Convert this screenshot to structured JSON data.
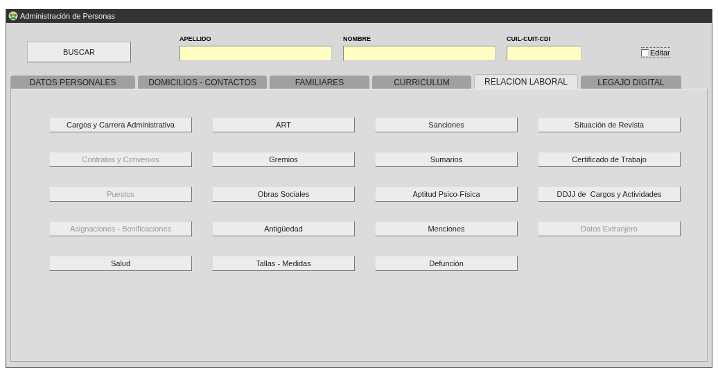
{
  "window": {
    "title": "Administración de Personas"
  },
  "search_button": "BUSCAR",
  "fields": [
    {
      "label": "APELLIDO"
    },
    {
      "label": "NOMBRE"
    },
    {
      "label": "CUIL-CUIT-CDI"
    }
  ],
  "edit_checkbox": {
    "label": "Editar",
    "checked": false
  },
  "tabs": [
    {
      "label": "DATOS PERSONALES",
      "selected": false
    },
    {
      "label": "DOMICILIOS - CONTACTOS",
      "selected": false
    },
    {
      "label": "FAMILIARES",
      "selected": false
    },
    {
      "label": "CURRICULUM",
      "selected": false
    },
    {
      "label": "RELACION LABORAL",
      "selected": true
    },
    {
      "label": "LEGAJO DIGITAL",
      "selected": false
    }
  ],
  "buttons": [
    {
      "label": "Cargos y Carrera Administrativa",
      "disabled": false
    },
    {
      "label": "ART",
      "disabled": false
    },
    {
      "label": "Sanciones",
      "disabled": false
    },
    {
      "label": "Situación de Revista",
      "disabled": false
    },
    {
      "label": "Contratos y Convenios",
      "disabled": true
    },
    {
      "label": "Gremios",
      "disabled": false
    },
    {
      "label": "Sumarios",
      "disabled": false
    },
    {
      "label": "Certificado de Trabajo",
      "disabled": false
    },
    {
      "label": "Puestos",
      "disabled": true
    },
    {
      "label": "Obras Sociales",
      "disabled": false
    },
    {
      "label": "Aptitud Psico-Física",
      "disabled": false
    },
    {
      "label": "DDJJ de  Cargos y Actividades",
      "disabled": false
    },
    {
      "label": "Asignaciones - Bonificaciones",
      "disabled": true
    },
    {
      "label": "Antigüedad",
      "disabled": false
    },
    {
      "label": "Menciones",
      "disabled": false
    },
    {
      "label": "Datos Extranjero",
      "disabled": true
    },
    {
      "label": "Salud",
      "disabled": false
    },
    {
      "label": "Tallas - Medidas",
      "disabled": false
    },
    {
      "label": "Defunción",
      "disabled": false
    }
  ]
}
